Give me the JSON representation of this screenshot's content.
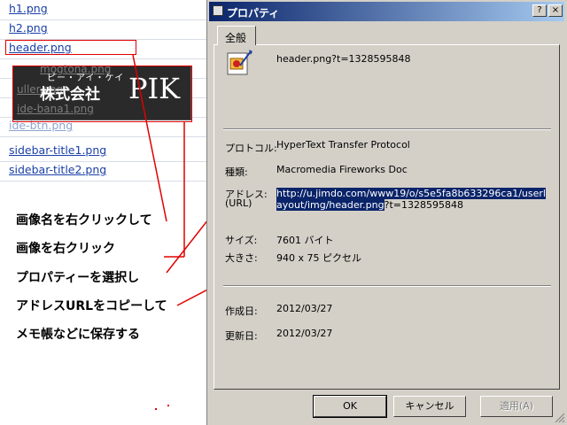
{
  "file_list": {
    "items": [
      "h1.png",
      "h2.png",
      "header.png",
      "mogtona.png",
      "uller.png",
      "ide-bana1.png",
      "ide-btn.png",
      "sidebar-title1.png",
      "sidebar-title2.png"
    ]
  },
  "preview": {
    "kana": "ピー・アイ・ケイ",
    "company": "株式会社",
    "logo": "PIK"
  },
  "instructions": [
    "画像名を右クリックして",
    "画像を右クリック",
    "プロパティーを選択し",
    "アドレスURLをコピーして",
    "メモ帳などに保存する"
  ],
  "dialog": {
    "title": "プロパティ",
    "help_btn": "?",
    "close_btn": "×",
    "tab_label": "全般",
    "file_name": "header.png?t=1328595848",
    "protocol_label": "プロトコル:",
    "protocol_value": "HyperText Transfer Protocol",
    "type_label": "種類:",
    "type_value": "Macromedia Fireworks Doc",
    "address_label": "アドレス:",
    "address_label2": "(URL)",
    "address_line1": "http://u.jimdo.com/www19/o/s5e5fa8b633296ca1/userl",
    "address_line2_selected": "ayout/img/header.png",
    "address_line2_rest": "?t=1328595848",
    "size_label": "サイズ:",
    "size_value": "7601 バイト",
    "dimensions_label": "大きさ:",
    "dimensions_value": "940  x  75  ピクセル",
    "created_label": "作成日:",
    "created_value": "2012/03/27",
    "modified_label": "更新日:",
    "modified_value": "2012/03/27",
    "ok_label": "OK",
    "cancel_label": "キャンセル",
    "apply_label": "適用(A)"
  },
  "colors": {
    "annotation": "#e00000",
    "link": "#1a3fa8",
    "selection": "#0a246a"
  }
}
